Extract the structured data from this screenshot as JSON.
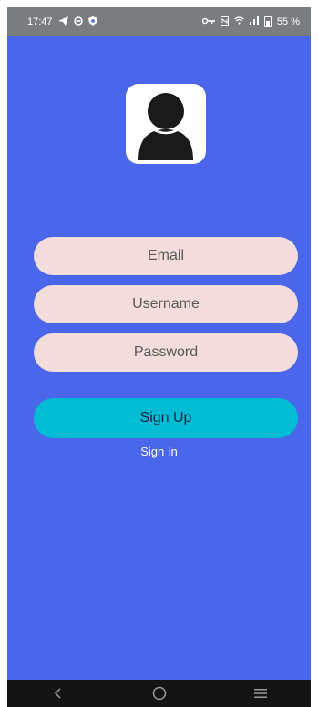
{
  "status_bar": {
    "time": "17:47",
    "battery_text": "55 %",
    "left_icons": [
      "telegram-icon",
      "vpn-icon",
      "shield-app-icon"
    ],
    "right_icons": [
      "key-icon",
      "nfc-icon",
      "wifi-icon",
      "signal-icon",
      "battery-icon"
    ]
  },
  "avatar": {
    "icon": "user-avatar-icon"
  },
  "form": {
    "email_placeholder": "Email",
    "username_placeholder": "Username",
    "password_placeholder": "Password",
    "signup_label": "Sign Up",
    "signin_label": "Sign In"
  },
  "colors": {
    "background": "#4a66ea",
    "field": "#f3dcdc",
    "button": "#00bcd4"
  },
  "nav_bar": {
    "icons": [
      "back-icon",
      "home-icon",
      "recents-icon"
    ]
  }
}
